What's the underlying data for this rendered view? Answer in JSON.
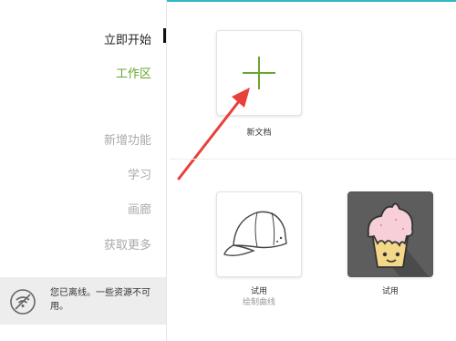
{
  "sidebar": {
    "items": [
      {
        "label": "立即开始"
      },
      {
        "label": "工作区"
      },
      {
        "label": "新增功能"
      },
      {
        "label": "学习"
      },
      {
        "label": "画廊"
      },
      {
        "label": "获取更多"
      }
    ],
    "offline_message": "您已离线。一些资源不可用。"
  },
  "main": {
    "new_document_label": "新文档",
    "templates": [
      {
        "label": "试用",
        "subtitle": "绘制曲线",
        "icon": "cap-icon"
      },
      {
        "label": "试用",
        "icon": "cupcake-icon"
      }
    ]
  },
  "colors": {
    "accent_green": "#6aa52d",
    "arrow_red": "#e8403a",
    "top_accent": "#2fb7c8"
  }
}
